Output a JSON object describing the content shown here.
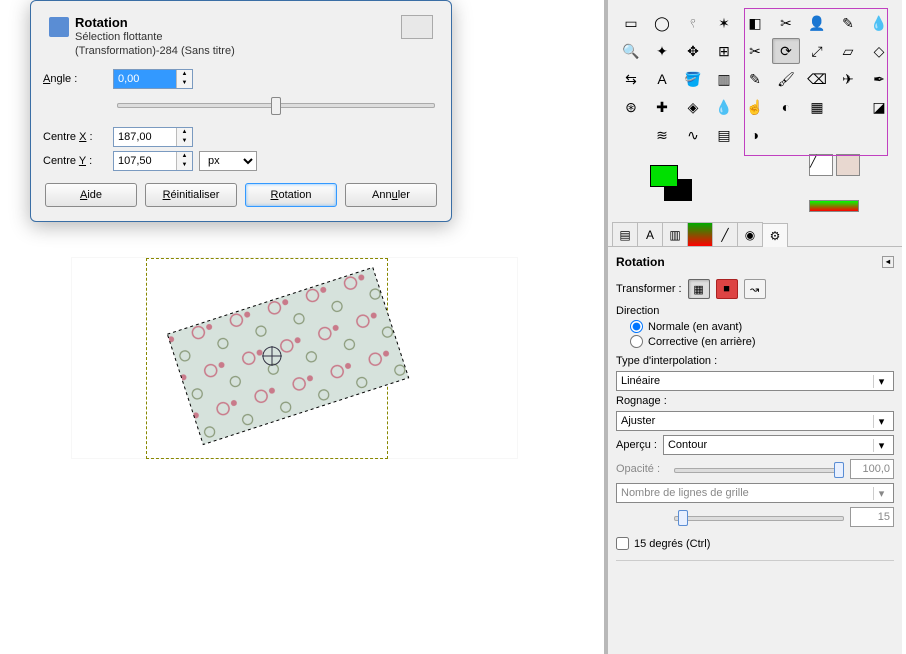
{
  "dialog": {
    "title": "Rotation",
    "subtitle1": "Sélection flottante",
    "subtitle2": "(Transformation)-284 (Sans titre)",
    "angle_label_pre": "A",
    "angle_label_post": "ngle :",
    "angle_value": "0,00",
    "center_x_label_pre": "Centre ",
    "center_x_label_ul": "X",
    "center_x_label_post": " :",
    "center_x_value": "187,00",
    "center_y_label_pre": "Centre ",
    "center_y_label_ul": "Y",
    "center_y_label_post": " :",
    "center_y_value": "107,50",
    "unit": "px",
    "buttons": {
      "help": "Aide",
      "help_ul": "A",
      "reset": "Réinitialiser",
      "reset_ul": "R",
      "rotate": "Rotation",
      "rotate_ul": "R",
      "cancel": "Annuler",
      "cancel_ul": "u"
    }
  },
  "toolbox": {
    "rows": [
      [
        "rect-select",
        "ellipse-select",
        "free-select",
        "fuzzy-select",
        "color-select",
        "scissors",
        "foreground-select",
        "paths",
        "color-picker"
      ],
      [
        "zoom",
        "measure",
        "move",
        "align",
        "crop",
        "rotate",
        "scale",
        "shear",
        "perspective"
      ],
      [
        "flip",
        "text",
        "bucket-fill",
        "blend",
        "pencil",
        "paintbrush",
        "eraser",
        "airbrush",
        "ink"
      ],
      [
        "clone",
        "heal",
        "perspective-clone",
        "blur",
        "smudge",
        "dodge",
        "cage",
        "",
        "color-tools"
      ],
      [
        "",
        "levels",
        "curves",
        "posterize",
        "desaturate",
        "",
        "",
        "",
        ""
      ]
    ],
    "icons": {
      "rect-select": "▭",
      "ellipse-select": "◯",
      "free-select": "𓍢",
      "fuzzy-select": "✶",
      "color-select": "◧",
      "scissors": "✂",
      "foreground-select": "👤",
      "paths": "✎",
      "color-picker": "💧",
      "zoom": "🔍",
      "measure": "✦",
      "move": "✥",
      "align": "⊞",
      "crop": "✂",
      "rotate": "⟳",
      "scale": "⤢",
      "shear": "▱",
      "perspective": "◇",
      "flip": "⇆",
      "text": "A",
      "bucket-fill": "🪣",
      "blend": "▥",
      "pencil": "✎",
      "paintbrush": "🖌",
      "eraser": "⌫",
      "airbrush": "✈",
      "ink": "✒",
      "clone": "⊛",
      "heal": "✚",
      "perspective-clone": "◈",
      "blur": "💧",
      "smudge": "☝",
      "dodge": "◐",
      "cage": "▦",
      "color-tools": "◪",
      "levels": "≋",
      "curves": "∿",
      "posterize": "▤",
      "desaturate": "◑"
    },
    "active": "rotate"
  },
  "options": {
    "title": "Rotation",
    "transform_label": "Transformer :",
    "direction_label": "Direction",
    "direction_normal": "Normale (en avant)",
    "direction_corrective": "Corrective (en arrière)",
    "interp_label": "Type d'interpolation :",
    "interp_value": "Linéaire",
    "clip_label": "Rognage :",
    "clip_value": "Ajuster",
    "preview_label": "Aperçu :",
    "preview_value": "Contour",
    "opacity_label": "Opacité :",
    "opacity_value": "100,0",
    "grid_lines_label": "Nombre de lignes de grille",
    "grid_lines_value": "15",
    "constrain_label": "15 degrés (Ctrl)"
  }
}
